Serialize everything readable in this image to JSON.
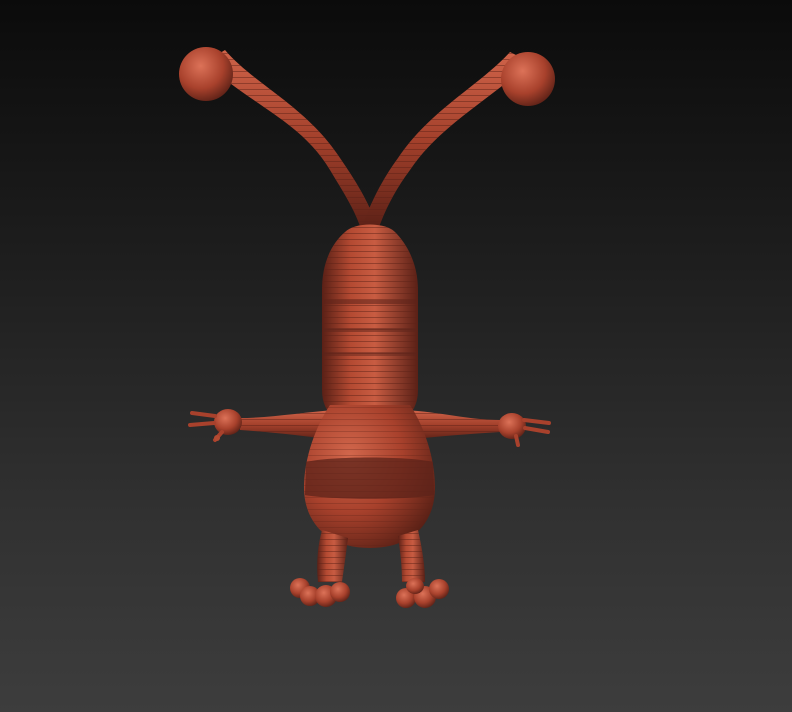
{
  "viewport": {
    "background_top": "#0b0b0b",
    "background_bottom": "#3d3d3d"
  },
  "model": {
    "material_base": "#a8412c",
    "material_highlight": "#d0654a",
    "material_shadow": "#4a1a12",
    "band_dark": "#5c231a"
  }
}
